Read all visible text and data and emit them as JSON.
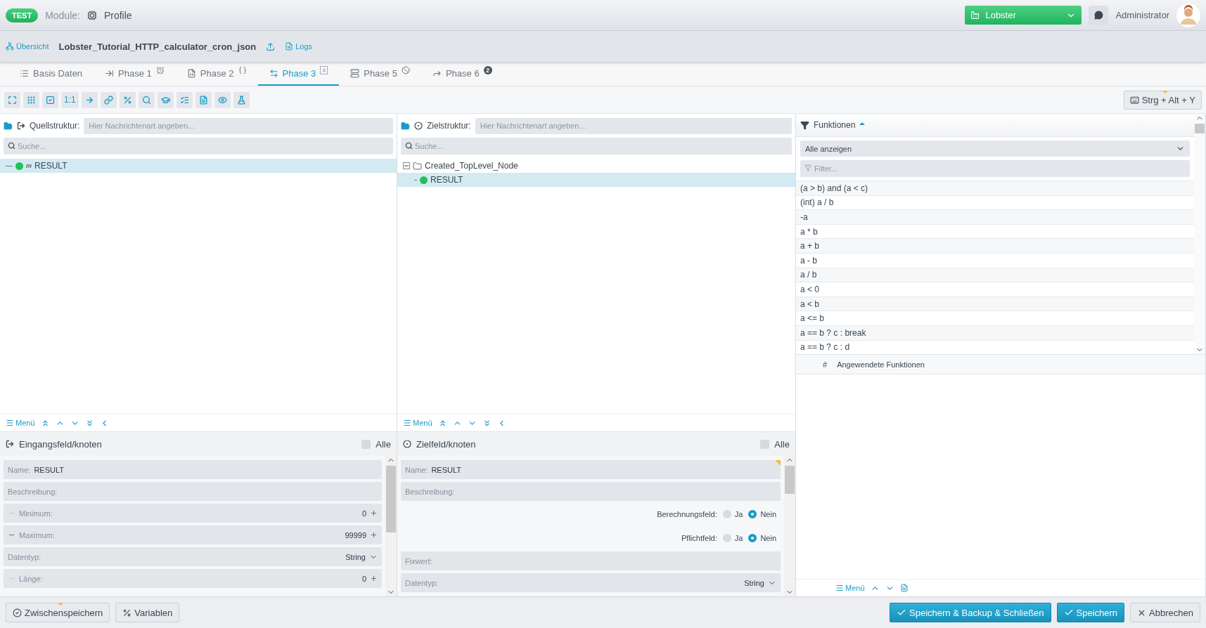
{
  "header": {
    "badge": "TEST",
    "module_label": "Module:",
    "module_name": "Profile",
    "company": "Lobster",
    "user": "Administrator"
  },
  "breadcrumb": {
    "overview": "Übersicht",
    "title": "Lobster_Tutorial_HTTP_calculator_cron_json",
    "logs": "Logs"
  },
  "tabs": [
    {
      "label": "Basis Daten",
      "selected": false
    },
    {
      "label": "Phase 1",
      "selected": false
    },
    {
      "label": "Phase 2",
      "selected": false
    },
    {
      "label": "Phase 3",
      "selected": true,
      "badge": "4"
    },
    {
      "label": "Phase 5",
      "selected": false
    },
    {
      "label": "Phase 6",
      "selected": false,
      "badge": "2"
    }
  ],
  "toolbar": {
    "ratio_button": "1:1",
    "shortcut": "Strg + Alt + Y"
  },
  "source": {
    "label": "Quellstruktur:",
    "placeholder": "Hier Nachrichtenart angeben...",
    "search_placeholder": "Suche...",
    "tree": [
      {
        "kind": "field",
        "label": "RESULT",
        "marker": "m",
        "selected": true
      }
    ],
    "menu": "Menü",
    "details": {
      "title": "Eingangsfeld/knoten",
      "all_label": "Alle",
      "all_checked": false,
      "fields": [
        {
          "kind": "text",
          "label": "Name:",
          "value": "RESULT"
        },
        {
          "kind": "text",
          "label": "Beschreibung:"
        },
        {
          "kind": "number",
          "label": "Minimum:",
          "value": "0",
          "decrement_disabled": true
        },
        {
          "kind": "number",
          "label": "Maximum:",
          "value": "99999",
          "decrement_disabled": false
        },
        {
          "kind": "select",
          "label": "Datentyp:",
          "value": "String"
        },
        {
          "kind": "number",
          "label": "Länge:",
          "value": "0",
          "decrement_disabled": true
        }
      ]
    }
  },
  "target": {
    "label": "Zielstruktur:",
    "placeholder": "Hier Nachrichtenart angeben...",
    "search_placeholder": "Suche...",
    "tree": [
      {
        "kind": "folder",
        "label": "Created_TopLevel_Node",
        "expanded": true,
        "selected": false,
        "children": [
          {
            "kind": "field",
            "label": "RESULT",
            "selected": true
          }
        ]
      }
    ],
    "menu": "Menü",
    "details": {
      "title": "Zielfeld/knoten",
      "all_label": "Alle",
      "all_checked": false,
      "fields": [
        {
          "kind": "text",
          "label": "Name:",
          "value": "RESULT"
        },
        {
          "kind": "text",
          "label": "Beschreibung:"
        },
        {
          "kind": "radio",
          "label": "Berechnungsfeld:",
          "options": [
            {
              "label": "Ja",
              "selected": false
            },
            {
              "label": "Nein",
              "selected": true
            }
          ]
        },
        {
          "kind": "radio",
          "label": "Pflichtfeld:",
          "options": [
            {
              "label": "Ja",
              "selected": false
            },
            {
              "label": "Nein",
              "selected": true
            }
          ]
        },
        {
          "kind": "text",
          "label": "Fixwert:"
        },
        {
          "kind": "select",
          "label": "Datentyp:",
          "value": "String"
        }
      ]
    }
  },
  "functions": {
    "title": "Funktionen",
    "select": "Alle anzeigen",
    "filter_placeholder": "Filter...",
    "items": [
      "(a > b) and (a < c)",
      "(int) a / b",
      "-a",
      "a * b",
      "a + b",
      "a - b",
      "a / b",
      "a < 0",
      "a < b",
      "a <= b",
      "a == b ? c : break",
      "a == b ? c : d"
    ],
    "applied_hash": "#",
    "applied_title": "Angewendete Funktionen",
    "menu": "Menü"
  },
  "footer": {
    "left": [
      {
        "label": "Zwischenspeichern",
        "kind": "save"
      },
      {
        "label": "Variablen",
        "kind": "variables"
      }
    ],
    "right": [
      {
        "label": "Speichern & Backup & Schließen",
        "kind": "primary"
      },
      {
        "label": "Speichern",
        "kind": "primary"
      },
      {
        "label": "Abbrechen",
        "kind": "cancel"
      }
    ]
  }
}
